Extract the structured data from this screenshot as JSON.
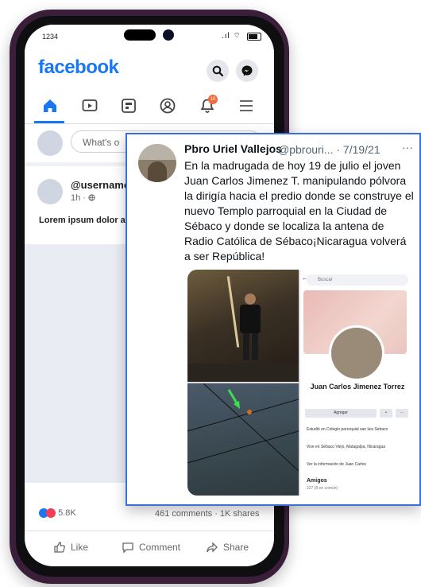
{
  "phone": {
    "status_time": "1234",
    "app_logo": "facebook",
    "composer_placeholder": "What's o",
    "post": {
      "username": "@username",
      "meta": "1h · ",
      "text": "Lorem ipsum dolor adipiscingelit.",
      "reactions_count": "5.8K",
      "comments_shares": "461 comments · 1K shares",
      "actions": {
        "like": "Like",
        "comment": "Comment",
        "share": "Share"
      }
    },
    "notification_badge": "10",
    "nav_icons": [
      "home-icon",
      "video-icon",
      "feeds-icon",
      "profile-icon",
      "notifications-icon",
      "menu-icon"
    ],
    "colors": {
      "brand": "#1877f2",
      "phone_frame": "#3a1e3a"
    }
  },
  "tweet": {
    "name": "Pbro Uriel Vallejos",
    "handle_date": "@pbrouri... · 7/19/21",
    "more": "···",
    "text": "En la madrugada de hoy 19 de julio el joven Juan Carlos Jimenez T. manipulando pólvora  la dirigía hacia el predio donde se construye el nuevo Templo parroquial en la Ciudad de Sébaco y donde se localiza la antena de Radio Católica de Sébaco¡Nicaragua volverá a ser República!",
    "border_color": "#3b6fd9",
    "embedded_profile": {
      "search_placeholder": "Buscar",
      "name": "Juan Carlos Jimenez Torrez",
      "add_button": "Agregar",
      "info_study": "Estudió en Colegio parroquial san luis Sebaco",
      "info_lives": "Vive en Sébaco Viejo, Matagalpa, Nicaragua",
      "info_more": "Ver la información de Juan Carlos",
      "friends_title": "Amigos",
      "friends_sub": "227 (8 en común)"
    }
  }
}
